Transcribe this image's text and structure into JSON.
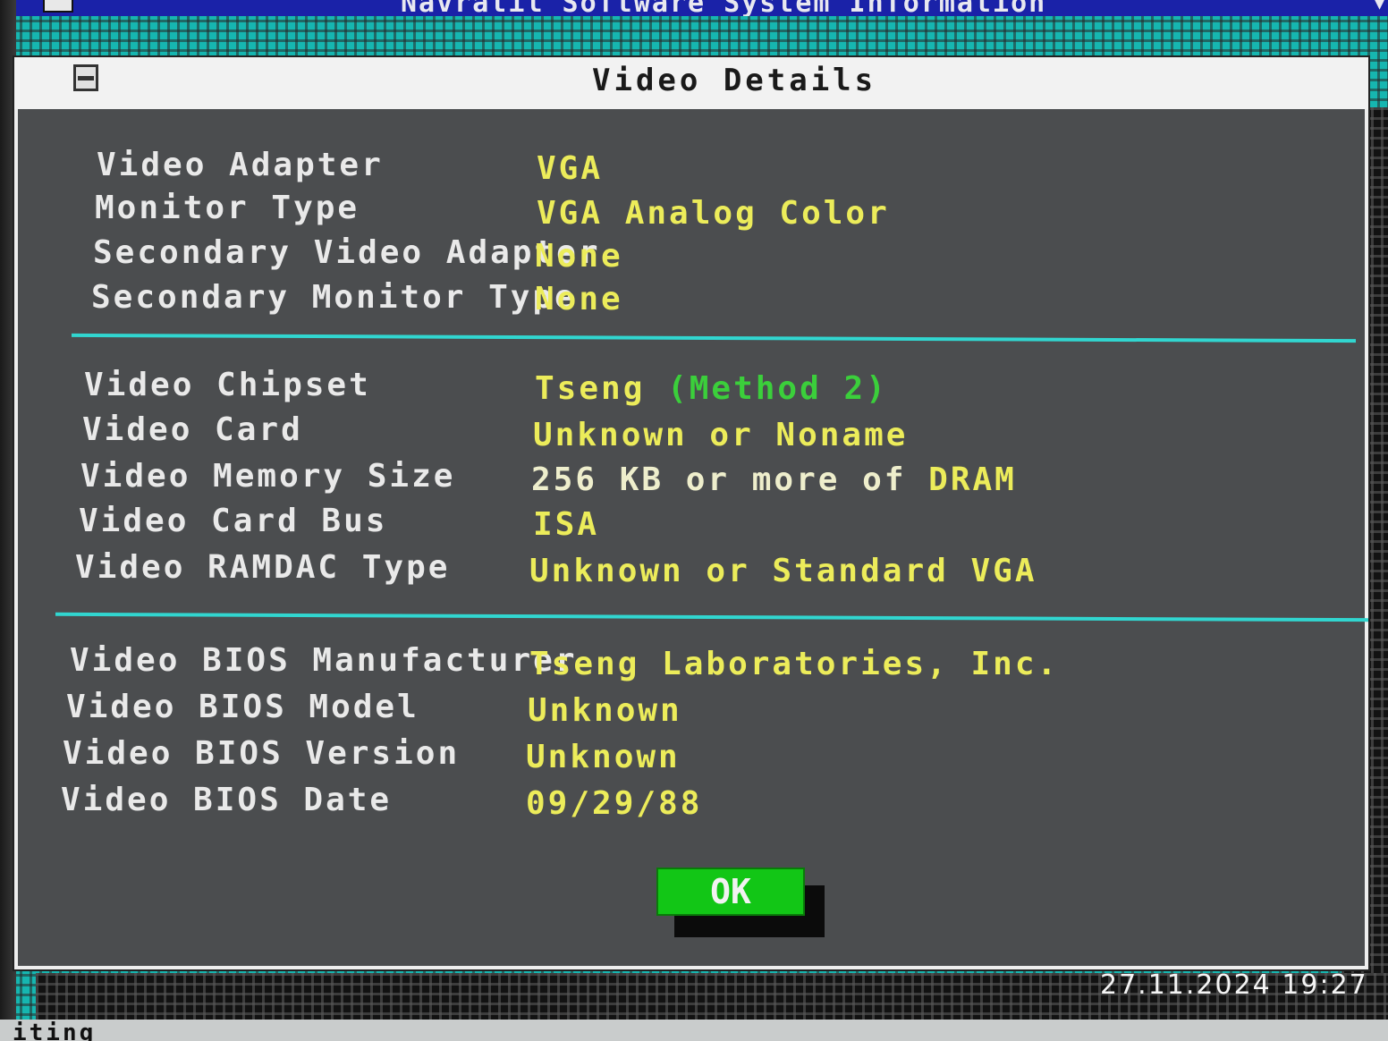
{
  "background": {
    "title_partial": "Navratil Software System Information",
    "bottom_partial": "iting"
  },
  "dialog": {
    "title": "Video Details",
    "section1": [
      {
        "label": "Video Adapter",
        "value": "VGA"
      },
      {
        "label": "Monitor Type",
        "value": "VGA Analog Color"
      },
      {
        "label": "Secondary Video Adapter",
        "value": "None"
      },
      {
        "label": "Secondary Monitor Type",
        "value": "None"
      }
    ],
    "section2": {
      "chipset": {
        "label": "Video Chipset",
        "value": "Tseng",
        "note": "(Method 2)"
      },
      "card": {
        "label": "Video Card",
        "value": "Unknown or Noname"
      },
      "memory": {
        "label": "Video Memory Size",
        "value": "256 KB or more of",
        "value_suffix": "DRAM"
      },
      "bus": {
        "label": "Video Card Bus",
        "value": "ISA"
      },
      "ramdac": {
        "label": "Video RAMDAC Type",
        "value": "Unknown or Standard VGA"
      }
    },
    "section3": [
      {
        "label": "Video BIOS Manufacturer",
        "value": "Tseng Laboratories, Inc."
      },
      {
        "label": "Video BIOS Model",
        "value": "Unknown"
      },
      {
        "label": "Video BIOS Version",
        "value": "Unknown"
      },
      {
        "label": "Video BIOS Date",
        "value": "09/29/88"
      }
    ],
    "ok_label": "OK"
  },
  "camera_timestamp": "27.11.2024  19:27",
  "colors": {
    "panel": "#4b4d4f",
    "label_text": "#e9e9e9",
    "value_text": "#ecec5a",
    "note_text": "#3bcf3b",
    "divider": "#31d6d0",
    "ok_button": "#12c616",
    "desktop": "#16b6b0"
  }
}
